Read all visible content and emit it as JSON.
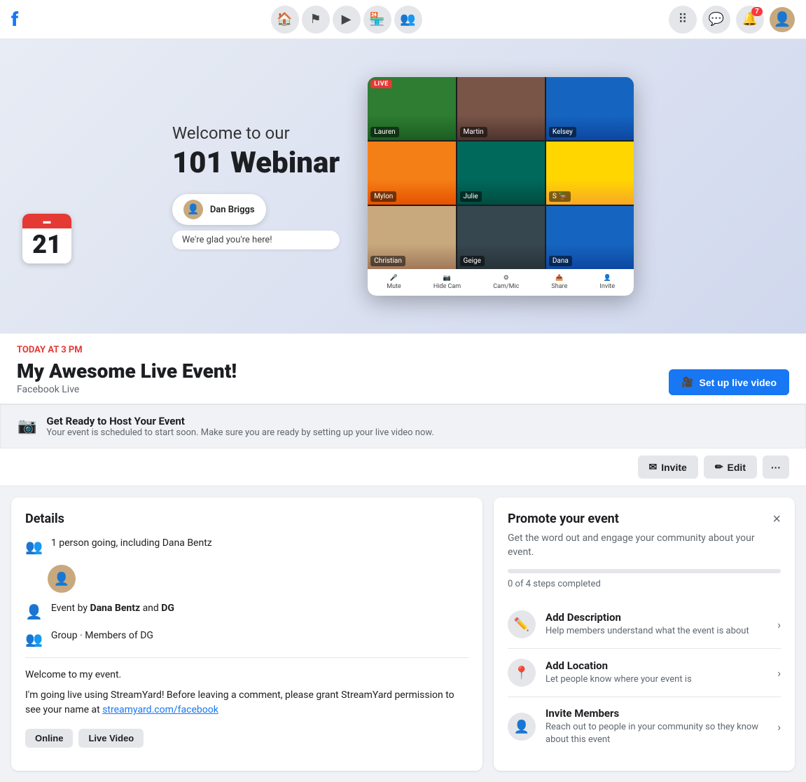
{
  "topnav": {
    "logo": "f",
    "notification_count": "7",
    "nav_icons": [
      "home",
      "flag",
      "play",
      "store",
      "group"
    ]
  },
  "hero": {
    "welcome_line1": "Welcome to our",
    "welcome_line2": "101 Webinar",
    "host_name": "Dan Briggs",
    "speech": "We're glad you're here!",
    "video_participants": [
      {
        "name": "Lauren",
        "tile_class": "tile-lauren"
      },
      {
        "name": "Martin",
        "tile_class": "tile-martin"
      },
      {
        "name": "Kelsey",
        "tile_class": "tile-kelsey"
      },
      {
        "name": "Mylon",
        "tile_class": "tile-mylon"
      },
      {
        "name": "Julie",
        "tile_class": "tile-julie"
      },
      {
        "name": "🦆",
        "tile_class": "tile-duck"
      },
      {
        "name": "Christian",
        "tile_class": "tile-christian"
      },
      {
        "name": "Geige",
        "tile_class": "tile-geige"
      },
      {
        "name": "Dana",
        "tile_class": "tile-dana"
      }
    ],
    "video_controls": [
      "Mute",
      "Hide Cam",
      "Cam/Mic",
      "Share",
      "Invite"
    ],
    "live_badge": "LIVE"
  },
  "calendar": {
    "day_number": "21"
  },
  "event_info": {
    "date_label": "TODAY AT 3 PM",
    "title": "My Awesome Live Event!",
    "subtitle": "Facebook Live",
    "set_up_btn": "Set up live video"
  },
  "ready_banner": {
    "title": "Get Ready to Host Your Event",
    "description": "Your event is scheduled to start soon. Make sure you are ready by setting up your live video now."
  },
  "action_bar": {
    "invite_btn": "Invite",
    "edit_btn": "Edit",
    "more_btn": "···"
  },
  "details": {
    "section_title": "Details",
    "attendees": "1 person going, including Dana Bentz",
    "organizer": "Event by Dana Bentz and DG",
    "group": "Group · Members of DG",
    "description_line1": "Welcome to my event.",
    "description_line2": "I'm going live using StreamYard! Before leaving a comment, please grant StreamYard permission to see your name at",
    "streamyard_link": "streamyard.com/facebook",
    "tags": [
      "Online",
      "Live Video"
    ]
  },
  "promote": {
    "title": "Promote your event",
    "close_btn": "×",
    "description": "Get the word out and engage your community about your event.",
    "progress_value": 0,
    "progress_max": 4,
    "progress_label": "0",
    "progress_suffix": "of 4 steps completed",
    "items": [
      {
        "icon": "✏️",
        "title": "Add Description",
        "description": "Help members understand what the event is about"
      },
      {
        "icon": "📍",
        "title": "Add Location",
        "description": "Let people know where your event is"
      },
      {
        "icon": "👤",
        "title": "Invite Members",
        "description": "Reach out to people in your community so they know about this event"
      }
    ]
  }
}
